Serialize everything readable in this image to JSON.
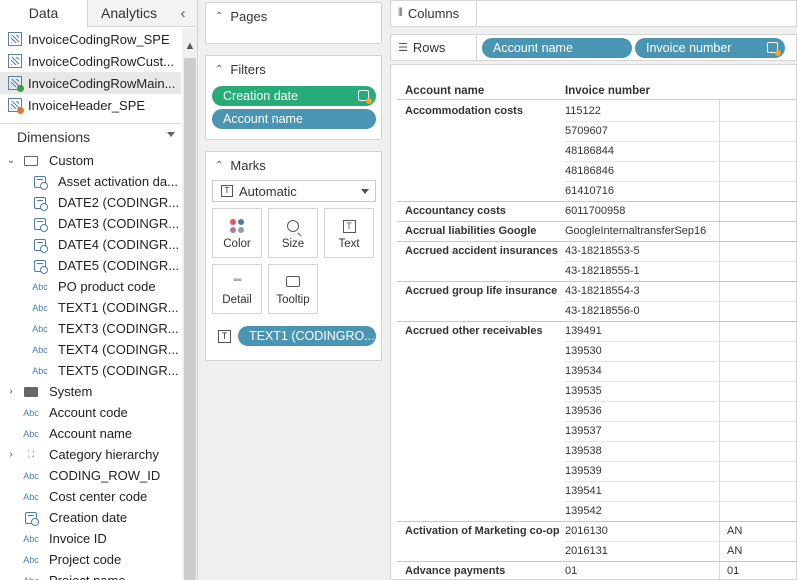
{
  "left_pane": {
    "tabs": [
      {
        "label": "Data"
      },
      {
        "label": "Analytics"
      }
    ],
    "collapse_glyph": "‹",
    "data_sources": [
      {
        "label": "InvoiceCodingRow_SPE",
        "badge": ""
      },
      {
        "label": "InvoiceCodingRowCust...",
        "badge": ""
      },
      {
        "label": "InvoiceCodingRowMain...",
        "badge": "#2f9f4f"
      },
      {
        "label": "InvoiceHeader_SPE",
        "badge": "#e07a2e"
      }
    ],
    "dimensions_header": "Dimensions",
    "fields": [
      {
        "label": "Custom",
        "icon": "folder-open-icon",
        "level": 0,
        "expander": "⌄"
      },
      {
        "label": "Asset activation da...",
        "icon": "calendar-icon",
        "level": 1
      },
      {
        "label": "DATE2 (CODINGR...",
        "icon": "calendar-icon",
        "level": 1
      },
      {
        "label": "DATE3 (CODINGR...",
        "icon": "calendar-icon",
        "level": 1
      },
      {
        "label": "DATE4 (CODINGR...",
        "icon": "calendar-icon",
        "level": 1
      },
      {
        "label": "DATE5 (CODINGR...",
        "icon": "calendar-icon",
        "level": 1
      },
      {
        "label": "PO product code",
        "icon": "Abc",
        "level": 1
      },
      {
        "label": "TEXT1 (CODINGR...",
        "icon": "Abc",
        "level": 1
      },
      {
        "label": "TEXT3 (CODINGR...",
        "icon": "Abc",
        "level": 1
      },
      {
        "label": "TEXT4 (CODINGR...",
        "icon": "Abc",
        "level": 1
      },
      {
        "label": "TEXT5 (CODINGR...",
        "icon": "Abc",
        "level": 1
      },
      {
        "label": "System",
        "icon": "folder-icon",
        "level": 0,
        "expander": "›"
      },
      {
        "label": "Account code",
        "icon": "Abc",
        "level": 0
      },
      {
        "label": "Account name",
        "icon": "Abc",
        "level": 0
      },
      {
        "label": "Category hierarchy",
        "icon": "hierarchy-icon",
        "level": 0,
        "expander": "›"
      },
      {
        "label": "CODING_ROW_ID",
        "icon": "Abc",
        "level": 0
      },
      {
        "label": "Cost center code",
        "icon": "Abc",
        "level": 0
      },
      {
        "label": "Creation date",
        "icon": "calendar-icon",
        "level": 0
      },
      {
        "label": "Invoice ID",
        "icon": "Abc",
        "level": 0
      },
      {
        "label": "Project code",
        "icon": "Abc",
        "level": 0
      },
      {
        "label": "Project name",
        "icon": "Abc",
        "level": 0
      }
    ]
  },
  "shelves": {
    "pages": {
      "title": "Pages"
    },
    "filters": {
      "title": "Filters",
      "pills": [
        "Creation date",
        "Account name"
      ]
    },
    "marks": {
      "title": "Marks",
      "type": "Automatic",
      "buttons": [
        "Color",
        "Size",
        "Text",
        "Detail",
        "Tooltip"
      ],
      "text_pill": "TEXT1 (CODINGRO..."
    },
    "columns": {
      "label": "Columns"
    },
    "rows": {
      "label": "Rows",
      "pills": [
        "Account name",
        "Invoice number"
      ]
    }
  },
  "view": {
    "headers": [
      "Account name",
      "Invoice number"
    ],
    "groups": [
      {
        "account": "Accommodation costs",
        "rows": [
          {
            "inv": "115122",
            "extra": ""
          },
          {
            "inv": "5709607",
            "extra": ""
          },
          {
            "inv": "48186844",
            "extra": ""
          },
          {
            "inv": "48186846",
            "extra": ""
          },
          {
            "inv": "61410716",
            "extra": ""
          }
        ]
      },
      {
        "account": "Accountancy costs",
        "rows": [
          {
            "inv": "6011700958",
            "extra": ""
          }
        ]
      },
      {
        "account": "Accrual liabilities Google",
        "rows": [
          {
            "inv": "GoogleInternaltransferSep16",
            "extra": ""
          }
        ]
      },
      {
        "account": "Accrued accident insurances",
        "rows": [
          {
            "inv": "43-18218553-5",
            "extra": ""
          },
          {
            "inv": "43-18218555-1",
            "extra": ""
          }
        ]
      },
      {
        "account": "Accrued group life insurance",
        "rows": [
          {
            "inv": "43-18218554-3",
            "extra": ""
          },
          {
            "inv": "43-18218556-0",
            "extra": ""
          }
        ]
      },
      {
        "account": "Accrued other receivables",
        "rows": [
          {
            "inv": "139491",
            "extra": ""
          },
          {
            "inv": "139530",
            "extra": ""
          },
          {
            "inv": "139534",
            "extra": ""
          },
          {
            "inv": "139535",
            "extra": ""
          },
          {
            "inv": "139536",
            "extra": ""
          },
          {
            "inv": "139537",
            "extra": ""
          },
          {
            "inv": "139538",
            "extra": ""
          },
          {
            "inv": "139539",
            "extra": ""
          },
          {
            "inv": "139541",
            "extra": ""
          },
          {
            "inv": "139542",
            "extra": ""
          }
        ]
      },
      {
        "account": "Activation of Marketing co-op",
        "rows": [
          {
            "inv": "2016130",
            "extra": "AN"
          },
          {
            "inv": "2016131",
            "extra": "AN"
          }
        ]
      },
      {
        "account": "Advance payments",
        "rows": [
          {
            "inv": "01",
            "extra": "01"
          }
        ]
      }
    ]
  }
}
